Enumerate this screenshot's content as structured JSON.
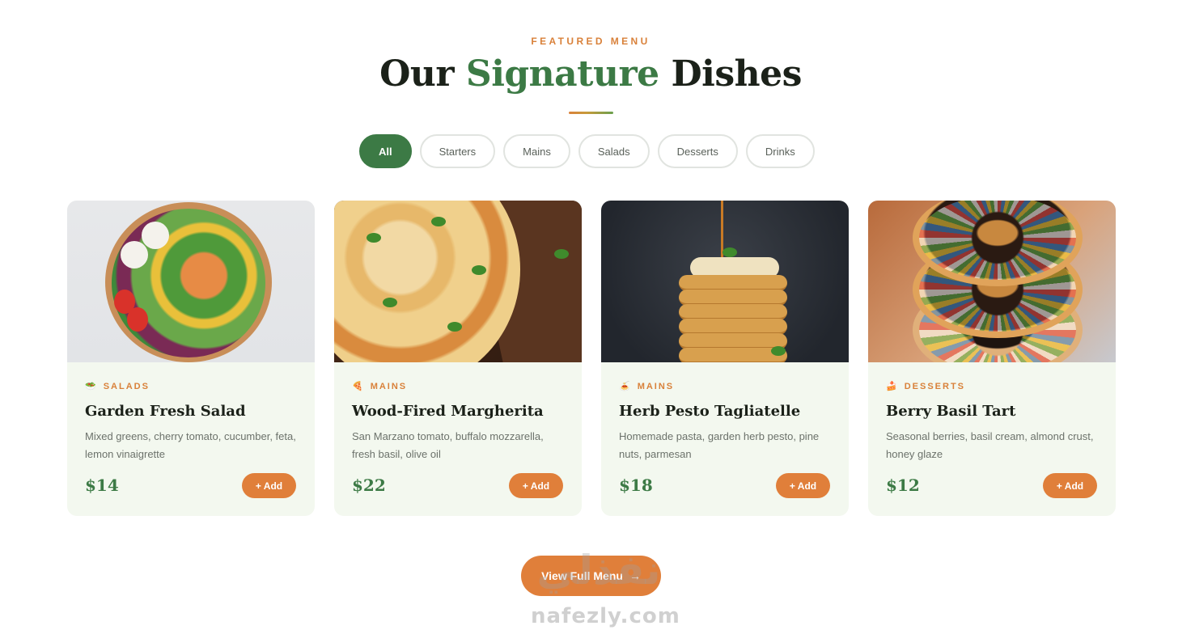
{
  "section": {
    "eyebrow": "FEATURED MENU",
    "title_part1": "Our",
    "title_accent": "Signature",
    "title_part2": "Dishes"
  },
  "filters": [
    "All",
    "Starters",
    "Mains",
    "Salads",
    "Desserts",
    "Drinks"
  ],
  "active_filter": "All",
  "dishes": [
    {
      "category": "SALADS",
      "category_icon": "🥗",
      "name": "Garden Fresh Salad",
      "description": "Mixed greens, cherry tomato, cucumber, feta, lemon vinaigrette",
      "price": "$14",
      "add_label": "+ Add",
      "image": "salad-bowl-photo"
    },
    {
      "category": "MAINS",
      "category_icon": "🍕",
      "name": "Wood-Fired Margherita",
      "description": "San Marzano tomato, buffalo mozzarella, fresh basil, olive oil",
      "price": "$22",
      "add_label": "+ Add",
      "image": "pizza-photo"
    },
    {
      "category": "MAINS",
      "category_icon": "🍝",
      "name": "Herb Pesto Tagliatelle",
      "description": "Homemade pasta, garden herb pesto, pine nuts, parmesan",
      "price": "$18",
      "add_label": "+ Add",
      "image": "pancake-stack-photo"
    },
    {
      "category": "DESSERTS",
      "category_icon": "🍰",
      "name": "Berry Basil Tart",
      "description": "Seasonal berries, basil cream, almond crust, honey glaze",
      "price": "$12",
      "add_label": "+ Add",
      "image": "donut-stack-photo"
    }
  ],
  "cta": {
    "label": "View Full Menu",
    "arrow": "→"
  },
  "watermark": {
    "arabic": "نفذلي",
    "latin": "nafezly.com"
  },
  "colors": {
    "accent_green": "#3c7a45",
    "accent_orange": "#e07f3a",
    "card_bg": "#f3f8ef"
  }
}
